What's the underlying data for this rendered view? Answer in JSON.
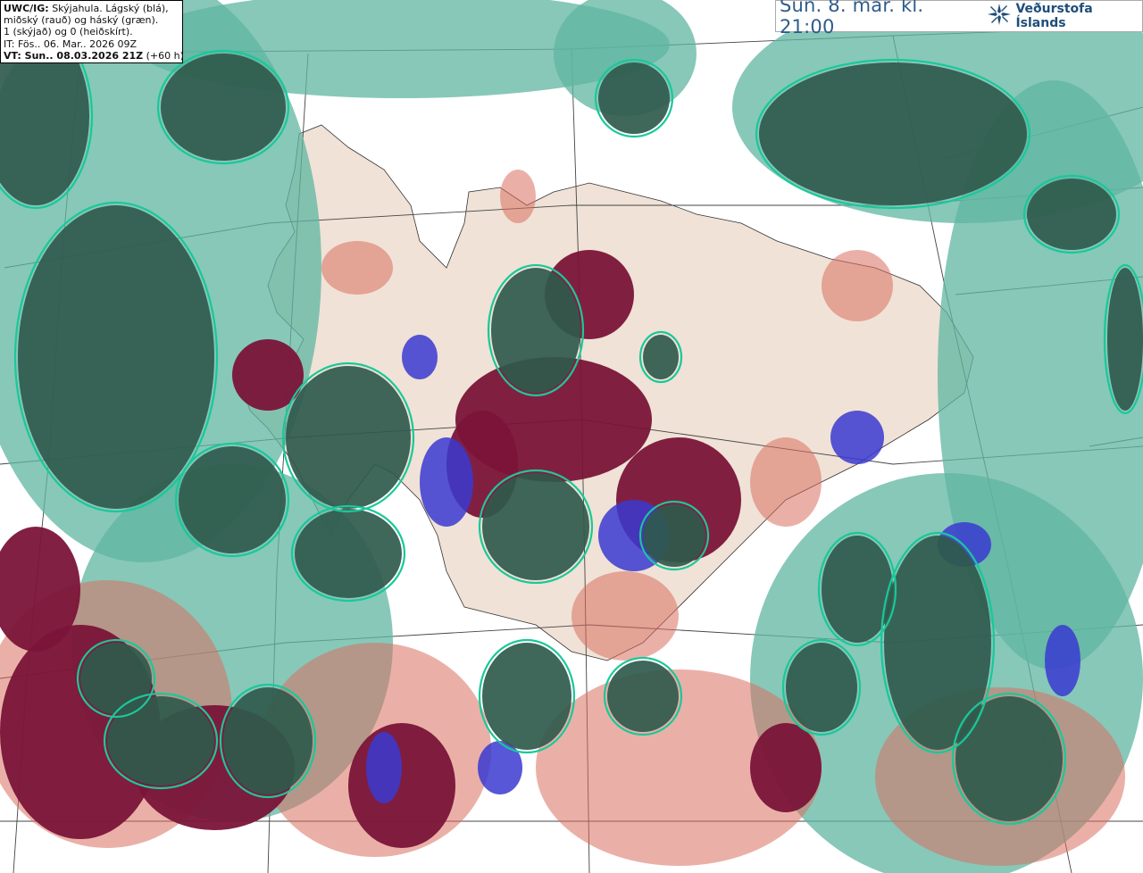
{
  "info_box": {
    "code_label": "UWC/IG:",
    "line1_rest": "Skýjahula. Lágský (blá),",
    "line2": "miðský (rauð) og háský (græn).",
    "line3": "1 (skýjað) og 0 (heiðskírt).",
    "line4": "IT: Fös.. 06. Mar.. 2026 09Z",
    "vt_label": "VT: Sun.. 08.03.2026 21Z",
    "vt_lead": "(+60 h)"
  },
  "valid_time": "Sun. 8. mar. kl. 21:00",
  "logo": {
    "icon": "snowflake-star-icon",
    "text": "Veðurstofa Íslands"
  },
  "colors": {
    "low_cloud": "#3a3ad0",
    "mid_cloud": "#7a1438",
    "mid_cloud_light": "#d87060",
    "high_cloud": "#2f5a4c",
    "high_cloud_light": "#5fb5a2",
    "contour": "#19c89a",
    "land": "#f0e2d6",
    "sea": "#ffffff"
  }
}
